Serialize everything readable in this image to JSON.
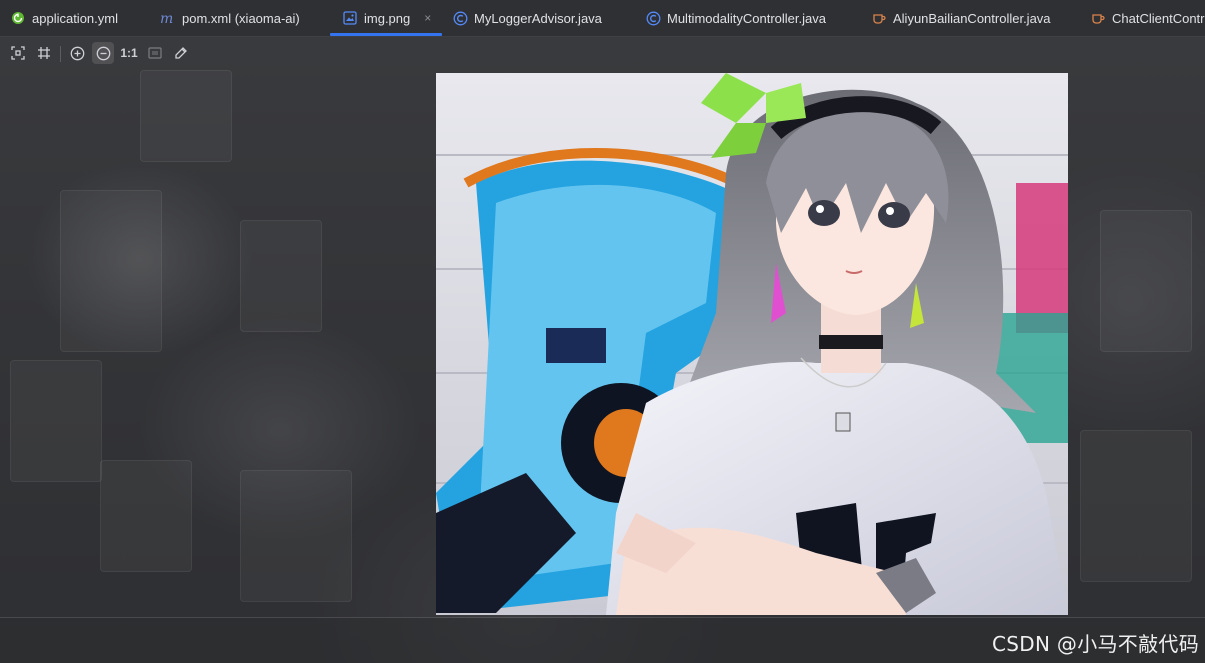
{
  "editor_tabs": [
    {
      "label": "application.yml",
      "icon": "spring-yaml-icon",
      "active": false
    },
    {
      "label": "pom.xml (xiaoma-ai)",
      "icon": "maven-icon",
      "active": false
    },
    {
      "label": "img.png",
      "icon": "image-file-icon",
      "active": true,
      "closable": true
    },
    {
      "label": "MyLoggerAdvisor.java",
      "icon": "java-class-icon",
      "active": false
    },
    {
      "label": "MultimodalityController.java",
      "icon": "java-class-icon",
      "active": false
    },
    {
      "label": "AliyunBailianController.java",
      "icon": "java-file-icon",
      "active": false
    },
    {
      "label": "ChatClientContro",
      "icon": "java-file-icon",
      "active": false
    }
  ],
  "close_glyph": "×",
  "toolbar": {
    "fit_icon": "fit-to-window-icon",
    "grid_icon": "grid-icon",
    "zoom_in_icon": "zoom-in-icon",
    "zoom_out_icon": "zoom-out-icon",
    "actual_size_label": "1:1",
    "background_icon": "background-toggle-icon",
    "color_picker_icon": "color-picker-icon"
  },
  "picture": {
    "description_icon": "anime-girl-image",
    "file": "img.png"
  },
  "watermark": "CSDN @小马不敲代码",
  "colors": {
    "accent": "#3574f0",
    "ide_background": "#2b2d30",
    "text": "#dfe1e5"
  }
}
